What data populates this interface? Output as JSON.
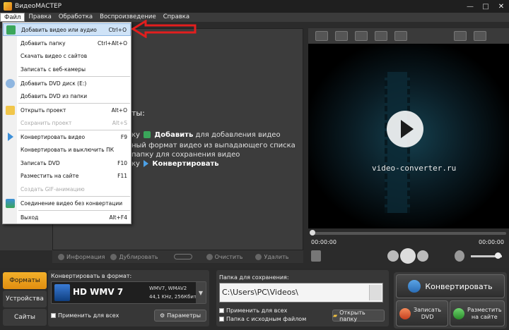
{
  "window": {
    "title": "ВидеоМАСТЕР"
  },
  "menu": [
    "Файл",
    "Правка",
    "Обработка",
    "Воспроизведение",
    "Справка"
  ],
  "dropdown": [
    {
      "label": "Добавить видео или аудио",
      "key": "Ctrl+O"
    },
    {
      "label": "Добавить папку",
      "key": "Ctrl+Alt+O"
    },
    {
      "label": "Скачать видео с сайтов",
      "key": ""
    },
    {
      "label": "Записать с веб-камеры",
      "key": ""
    },
    {
      "label": "Добавить DVD диск (E:)",
      "key": ""
    },
    {
      "label": "Добавить DVD из папки",
      "key": ""
    },
    {
      "label": "Открыть проект",
      "key": "Alt+O"
    },
    {
      "label": "Сохранить проект",
      "key": "Alt+S"
    },
    {
      "label": "Конвертировать видео",
      "key": "F9"
    },
    {
      "label": "Конвертировать и выключить ПК",
      "key": ""
    },
    {
      "label": "Записать DVD",
      "key": "F10"
    },
    {
      "label": "Разместить на сайте",
      "key": "F11"
    },
    {
      "label": "Создать GIF-анимацию",
      "key": ""
    },
    {
      "label": "Соединение видео без конвертации",
      "key": ""
    },
    {
      "label": "Выход",
      "key": "Alt+F4"
    }
  ],
  "hints": {
    "heading": "ты:",
    "line1a": "ку",
    "line1b": "Добавить",
    "line1c": "для добавления видео",
    "line2": "ный формат видео из выпадающего списка",
    "line3": "папку для сохранения видео",
    "line4a": "ку",
    "line4b": "Конвертировать"
  },
  "worktool": {
    "info": "Информация",
    "duplicate": "Дублировать",
    "clear": "Очистить",
    "delete": "Удалить"
  },
  "preview": {
    "watermark": "video-converter.ru",
    "time_current": "00:00:00",
    "time_total": "00:00:00"
  },
  "side": {
    "formats": "Форматы",
    "devices": "Устройства",
    "sites": "Сайты"
  },
  "format": {
    "label": "Конвертировать в формат:",
    "name": "HD WMV 7",
    "codec": "WMV7, WMAV2",
    "audio": "44,1 KHz, 256Кбит",
    "apply_all": "Применить для всех",
    "params": "Параметры"
  },
  "save": {
    "label": "Папка для сохранения:",
    "path": "C:\\Users\\PC\\Videos\\",
    "apply_all": "Применить для всех",
    "source_folder": "Папка с исходным файлом",
    "open_folder": "Открыть папку"
  },
  "actions": {
    "convert": "Конвертировать",
    "burn1": "Записать",
    "burn2": "DVD",
    "publish1": "Разместить",
    "publish2": "на сайте"
  }
}
